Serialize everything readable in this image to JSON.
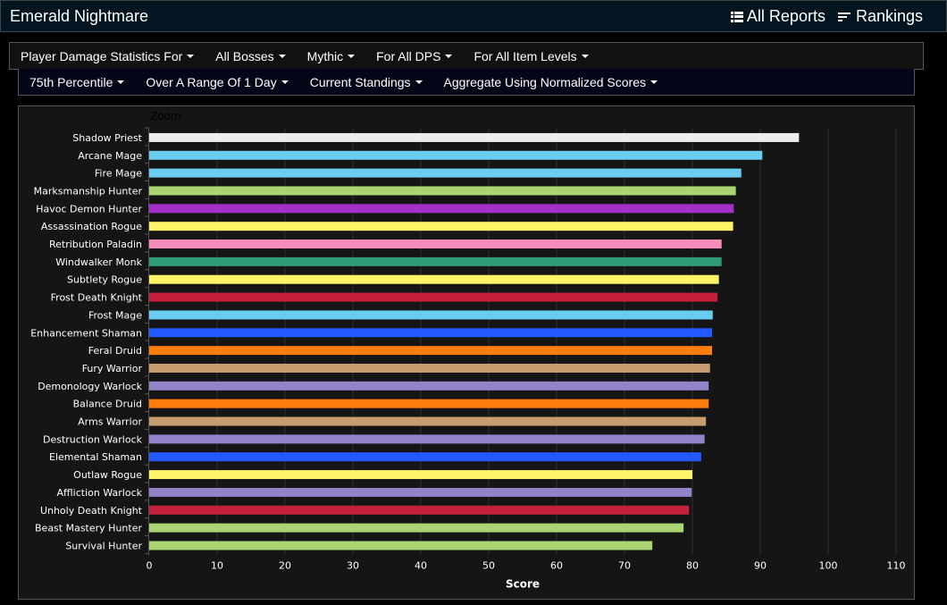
{
  "header": {
    "title": "Emerald Nightmare",
    "nav": [
      {
        "label": "All Reports",
        "icon": "list-icon"
      },
      {
        "label": "Rankings",
        "icon": "sort-icon"
      }
    ]
  },
  "filters_row1": [
    "Player Damage Statistics For",
    "All Bosses",
    "Mythic",
    "For All DPS",
    "For All Item Levels"
  ],
  "filters_row2": [
    "75th Percentile",
    "Over A Range Of 1 Day",
    "Current Standings",
    "Aggregate Using Normalized Scores"
  ],
  "chart_zoom_label": "Zoom",
  "chart_data": {
    "type": "bar",
    "orientation": "horizontal",
    "title": "",
    "xlabel": "Score",
    "ylabel": "",
    "xlim": [
      0,
      110
    ],
    "xticks": [
      0,
      10,
      20,
      30,
      40,
      50,
      60,
      70,
      80,
      90,
      100,
      110
    ],
    "grid": true,
    "categories": [
      "Shadow Priest",
      "Arcane Mage",
      "Fire Mage",
      "Marksmanship Hunter",
      "Havoc Demon Hunter",
      "Assassination Rogue",
      "Retribution Paladin",
      "Windwalker Monk",
      "Subtlety Rogue",
      "Frost Death Knight",
      "Frost Mage",
      "Enhancement Shaman",
      "Feral Druid",
      "Fury Warrior",
      "Demonology Warlock",
      "Balance Druid",
      "Arms Warrior",
      "Destruction Warlock",
      "Elemental Shaman",
      "Outlaw Rogue",
      "Affliction Warlock",
      "Unholy Death Knight",
      "Beast Mastery Hunter",
      "Survival Hunter"
    ],
    "values": [
      95.7,
      90.3,
      87.2,
      86.4,
      86.1,
      86.0,
      84.3,
      84.3,
      83.9,
      83.7,
      83.0,
      82.9,
      82.9,
      82.6,
      82.4,
      82.4,
      82.0,
      81.8,
      81.3,
      80.0,
      79.9,
      79.5,
      78.7,
      74.1
    ],
    "colors": [
      "#ededed",
      "#69ccf0",
      "#69ccf0",
      "#abd473",
      "#a330c9",
      "#fff468",
      "#f58cba",
      "#2e9b78",
      "#fff468",
      "#c41f3b",
      "#69ccf0",
      "#2459ff",
      "#ff7d0a",
      "#c79c6e",
      "#9482c9",
      "#ff7d0a",
      "#c79c6e",
      "#9482c9",
      "#2459ff",
      "#fff468",
      "#9482c9",
      "#c41f3b",
      "#abd473",
      "#abd473"
    ]
  }
}
